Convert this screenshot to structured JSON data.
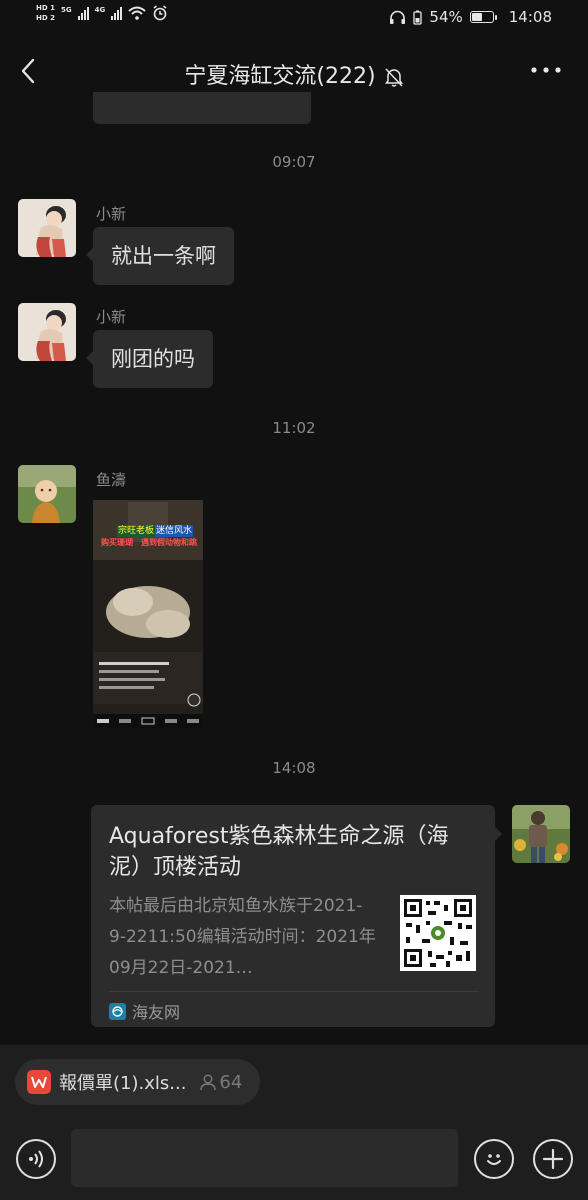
{
  "status_bar": {
    "hd1": "HD 1",
    "hd2": "HD 2",
    "net1": "5G",
    "net2": "4G",
    "battery_percent": "54%",
    "battery_level": 0.54,
    "time": "14:08"
  },
  "header": {
    "title": "宁夏海缸交流(222)"
  },
  "messages": [
    {
      "type": "time",
      "text": "09:07"
    },
    {
      "type": "text",
      "sender": "小新",
      "text": "就出一条啊"
    },
    {
      "type": "text",
      "sender": "小新",
      "text": "刚团的吗"
    },
    {
      "type": "time",
      "text": "11:02"
    },
    {
      "type": "video",
      "sender": "鱼濤",
      "overlay": {
        "tag1": "宗旺老板",
        "tag2": "迷信风水",
        "line1": "购买珊瑚",
        "line2": "遇到假动物和跳"
      }
    },
    {
      "type": "time",
      "text": "14:08"
    },
    {
      "type": "link",
      "sender": "self",
      "title": "Aquaforest紫色森林生命之源（海泥）顶楼活动",
      "desc": "本帖最后由北京知鱼水族于2021-9-2211:50编辑活动时间：2021年09月22日-2021…",
      "source": "海友网"
    }
  ],
  "bottom": {
    "file_name": "報價單(1).xls...",
    "file_views": "64"
  },
  "colors": {
    "background": "#111111",
    "bubble": "#2c2c2c",
    "file_icon": "#e8473a"
  }
}
